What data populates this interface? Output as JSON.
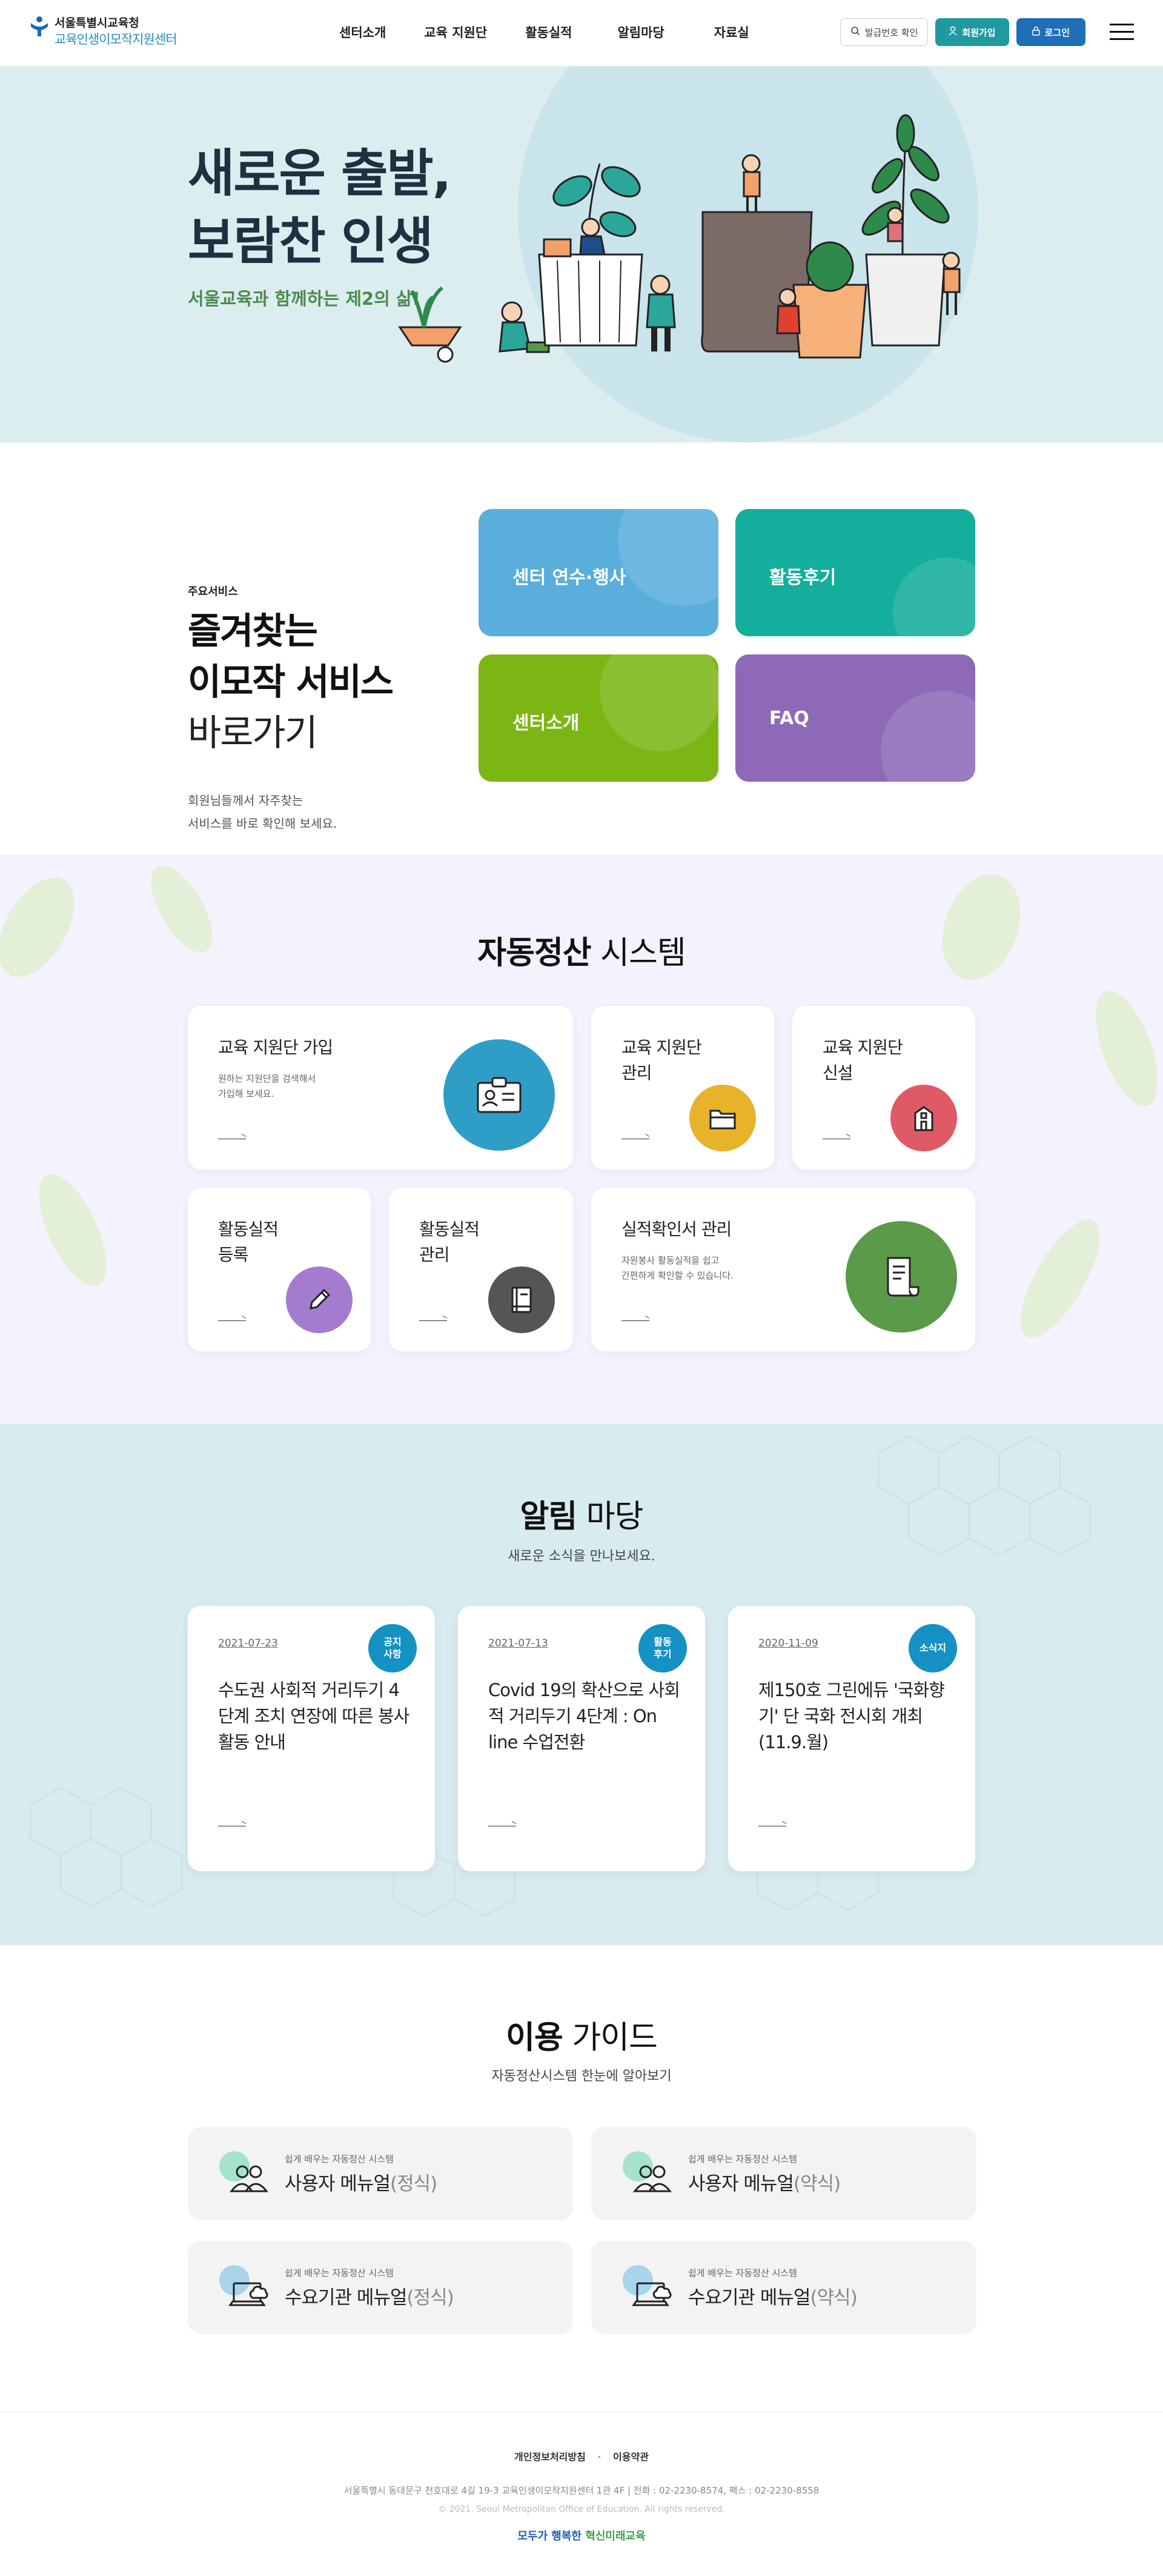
{
  "header": {
    "logo_top": "서울특별시교육청",
    "logo_bottom": "교육인생이모작지원센터",
    "nav": [
      "센터소개",
      "교육 지원단",
      "활동실적",
      "알림마당",
      "자료실"
    ],
    "search_label": "발급번호 확인",
    "join_label": "회원가입",
    "login_label": "로그인"
  },
  "hero": {
    "title_line1": "새로운 출발,",
    "title_line2": "보람찬 인생",
    "subtitle": "서울교육과 함께하는 제2의 삶!"
  },
  "services": {
    "label": "주요서비스",
    "heading_bold1": "즐겨찾는",
    "heading_bold2": "이모작 서비스",
    "heading_light": "바로가기",
    "desc_line1": "회원님들께서 자주찾는",
    "desc_line2": "서비스를 바로 확인해 보세요.",
    "tiles": [
      {
        "label": "센터 연수·행사",
        "color": "#5aaedc"
      },
      {
        "label": "활동후기",
        "color": "#14ae9c"
      },
      {
        "label": "센터소개",
        "color": "#7cb614"
      },
      {
        "label": "FAQ",
        "color": "#8e69b8"
      }
    ]
  },
  "auto_system": {
    "title_bold": "자동정산",
    "title_light": " 시스템",
    "cards": [
      {
        "title_l1": "교육 지원단 가입",
        "title_l2": "",
        "desc_l1": "원하는 지원단을 검색해서",
        "desc_l2": "가입해 보세요.",
        "icon": "id-card-icon",
        "color": "#2e9ec6"
      },
      {
        "title_l1": "교육 지원단",
        "title_l2": "관리",
        "desc_l1": "",
        "desc_l2": "",
        "icon": "folder-icon",
        "color": "#e6b32a"
      },
      {
        "title_l1": "교육 지원단",
        "title_l2": "신설",
        "desc_l1": "",
        "desc_l2": "",
        "icon": "building-icon",
        "color": "#e05a66"
      },
      {
        "title_l1": "활동실적",
        "title_l2": "등록",
        "desc_l1": "",
        "desc_l2": "",
        "icon": "pencil-icon",
        "color": "#a37cd0"
      },
      {
        "title_l1": "활동실적",
        "title_l2": "관리",
        "desc_l1": "",
        "desc_l2": "",
        "icon": "book-icon",
        "color": "#555555"
      },
      {
        "title_l1": "실적확인서 관리",
        "title_l2": "",
        "desc_l1": "자원봉사 활동실적을 쉽고",
        "desc_l2": "간편하게 확인할 수 있습니다.",
        "icon": "certificate-icon",
        "color": "#5a9a48"
      }
    ]
  },
  "notice": {
    "title_bold": "알림",
    "title_light": " 마당",
    "subtitle": "새로운 소식을 만나보세요.",
    "cards": [
      {
        "date": "2021-07-23",
        "badge_l1": "공지",
        "badge_l2": "사항",
        "title": "수도권 사회적 거리두기 4단계 조치 연장에 따른 봉사활동 안내"
      },
      {
        "date": "2021-07-13",
        "badge_l1": "활동",
        "badge_l2": "후기",
        "title": "Covid 19의 확산으로 사회적 거리두기 4단계 : On line 수업전환"
      },
      {
        "date": "2020-11-09",
        "badge_l1": "소식지",
        "badge_l2": "",
        "title": "제150호 그린에듀 '국화향기' 단 국화 전시회 개최(11.9.월)"
      }
    ]
  },
  "guide": {
    "title_bold": "이용",
    "title_light": " 가이드",
    "subtitle": "자동정산시스템 한눈에 알아보기",
    "cards": [
      {
        "small": "쉽게 배우는 자동정산 시스템",
        "main": "사용자 메뉴얼",
        "sub": "(정식)",
        "icon": "users-icon",
        "accent": "#a6e3c9"
      },
      {
        "small": "쉽게 배우는 자동정산 시스템",
        "main": "사용자 메뉴얼",
        "sub": "(약식)",
        "icon": "users-icon",
        "accent": "#a6e3c9"
      },
      {
        "small": "쉽게 배우는 자동정산 시스템",
        "main": "수요기관 메뉴얼",
        "sub": "(정식)",
        "icon": "laptop-cloud-icon",
        "accent": "#a8d4ec"
      },
      {
        "small": "쉽게 배우는 자동정산 시스템",
        "main": "수요기관 메뉴얼",
        "sub": "(약식)",
        "icon": "laptop-cloud-icon",
        "accent": "#a8d4ec"
      }
    ]
  },
  "footer": {
    "privacy": "개인정보처리방침",
    "terms": "이용약관",
    "address": "서울특별시 동대문구 천호대로 4길 19-3 교육인생이모작지원센터 1관 4F  |  전화 : 02-2230-8574, 팩스 : 02-2230-8558",
    "copyright": "© 2021. Seoul Metropolitan Office of Education. All rights reserved.",
    "slogan_a": "모두가 행복한 ",
    "slogan_b": "혁신미래교육"
  }
}
